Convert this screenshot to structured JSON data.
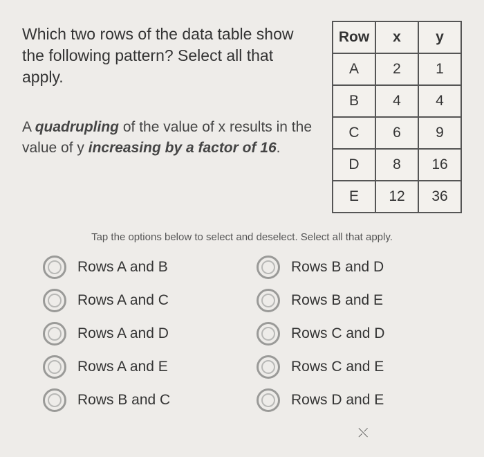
{
  "question": "Which two rows of the data table show the following pattern? Select all that apply.",
  "pattern": {
    "p1": "A ",
    "p2": "quadrupling",
    "p3": " of the value of x results in the value of y ",
    "p4": "increasing by a factor of 16",
    "p5": "."
  },
  "table": {
    "headers": {
      "c0": "Row",
      "c1": "x",
      "c2": "y"
    },
    "rows": [
      {
        "r": "A",
        "x": "2",
        "y": "1"
      },
      {
        "r": "B",
        "x": "4",
        "y": "4"
      },
      {
        "r": "C",
        "x": "6",
        "y": "9"
      },
      {
        "r": "D",
        "x": "8",
        "y": "16"
      },
      {
        "r": "E",
        "x": "12",
        "y": "36"
      }
    ]
  },
  "instruction": "Tap the options below to select and deselect. Select all that apply.",
  "options": {
    "left": [
      "Rows A and B",
      "Rows A and C",
      "Rows A and D",
      "Rows A and E",
      "Rows B and C"
    ],
    "right": [
      "Rows B and D",
      "Rows B and E",
      "Rows C and D",
      "Rows C and E",
      "Rows D and E"
    ]
  },
  "chart_data": {
    "type": "table",
    "columns": [
      "Row",
      "x",
      "y"
    ],
    "rows": [
      [
        "A",
        2,
        1
      ],
      [
        "B",
        4,
        4
      ],
      [
        "C",
        6,
        9
      ],
      [
        "D",
        8,
        16
      ],
      [
        "E",
        12,
        36
      ]
    ]
  }
}
